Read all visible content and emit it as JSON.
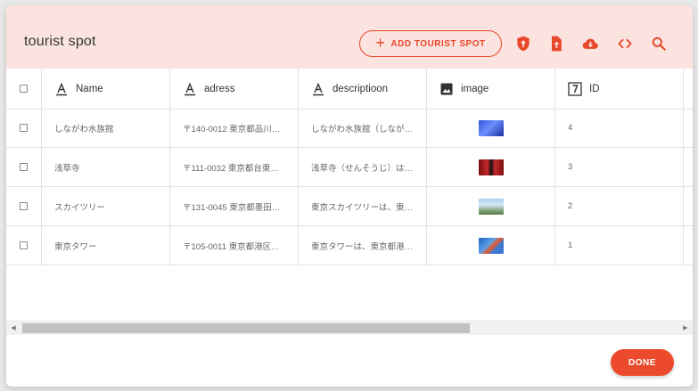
{
  "dialog": {
    "title": "tourist spot",
    "add_button_label": "ADD TOURIST SPOT",
    "done_label": "DONE",
    "accent_color": "#e8472a",
    "header_icons": [
      "shield-icon",
      "upload-file-icon",
      "cloud-download-icon",
      "code-icon",
      "search-icon"
    ]
  },
  "table": {
    "columns": [
      {
        "label": "Name",
        "icon": "text-type-icon"
      },
      {
        "label": "adress",
        "icon": "text-type-icon"
      },
      {
        "label": "descriptioon",
        "icon": "text-type-icon"
      },
      {
        "label": "image",
        "icon": "image-type-icon"
      },
      {
        "label": "ID",
        "icon": "number-type-icon"
      }
    ],
    "rows": [
      {
        "name": "しながわ水族館",
        "address": "〒140-0012 東京都品川…",
        "description": "しながわ水族館（しなが…",
        "image": "aquarium-thumbnail",
        "id": "4"
      },
      {
        "name": "浅草寺",
        "address": "〒111-0032 東京都台東…",
        "description": "浅草寺（せんそうじ）は…",
        "image": "temple-thumbnail",
        "id": "3"
      },
      {
        "name": "スカイツリー",
        "address": "〒131-0045 東京都墨田…",
        "description": "東京スカイツリーは、東…",
        "image": "skytree-thumbnail",
        "id": "2"
      },
      {
        "name": "東京タワー",
        "address": "〒105-0011 東京都港区…",
        "description": "東京タワーは、東京都港…",
        "image": "tower-thumbnail",
        "id": "1"
      }
    ]
  }
}
